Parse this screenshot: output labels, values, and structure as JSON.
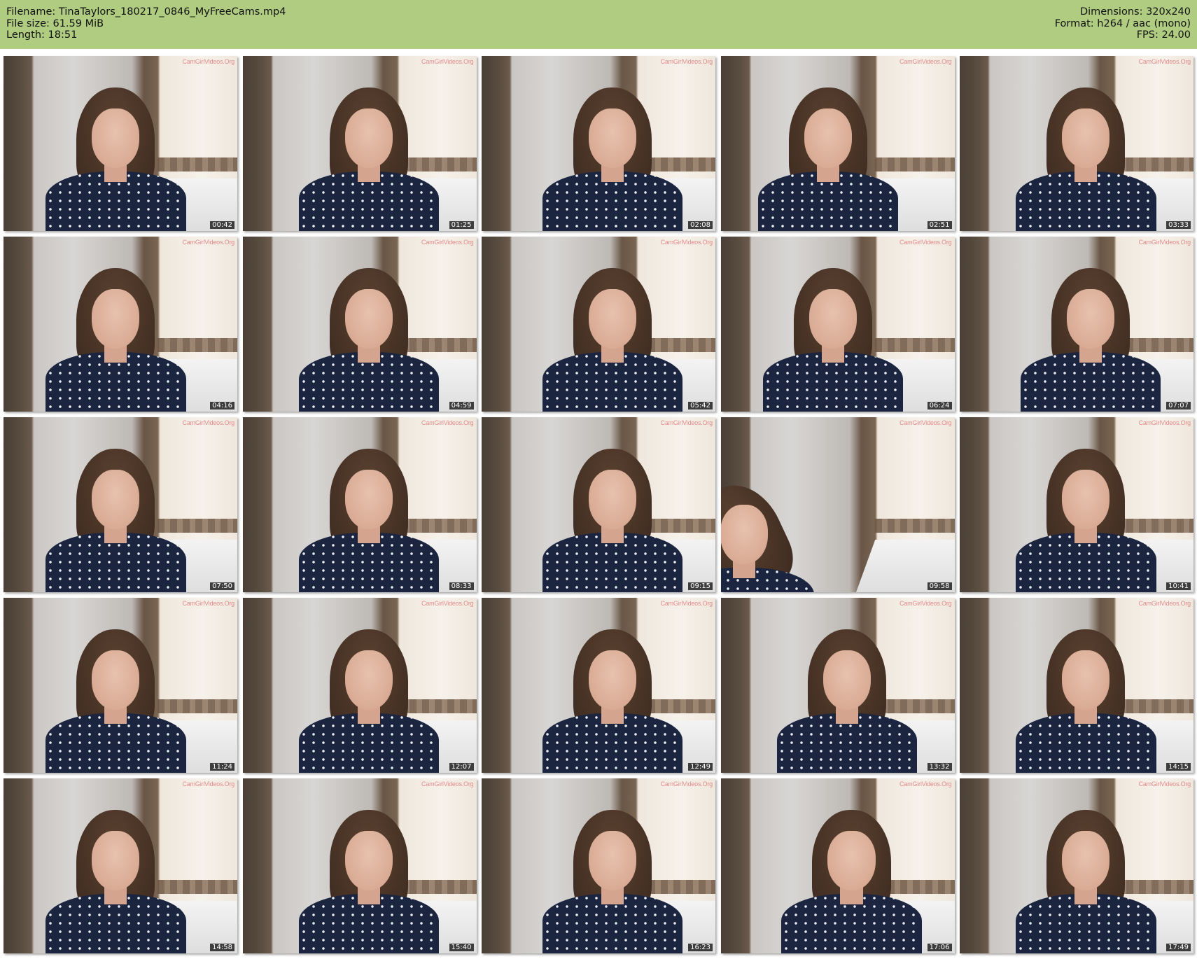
{
  "header": {
    "left": [
      {
        "label": "Filename:",
        "value": "TinaTaylors_180217_0846_MyFreeCams.mp4"
      },
      {
        "label": "File size:",
        "value": "61.59 MiB"
      },
      {
        "label": "Length:",
        "value": "18:51"
      }
    ],
    "right": [
      {
        "label": "Dimensions:",
        "value": "320x240"
      },
      {
        "label": "Format:",
        "value": "h264 / aac (mono)"
      },
      {
        "label": "FPS:",
        "value": "24.00"
      }
    ]
  },
  "watermark_text": "CamGirlVideos.Org",
  "thumbnails": [
    {
      "time": "00:42"
    },
    {
      "time": "01:25"
    },
    {
      "time": "02:08"
    },
    {
      "time": "02:51"
    },
    {
      "time": "03:33"
    },
    {
      "time": "04:16"
    },
    {
      "time": "04:59"
    },
    {
      "time": "05:42"
    },
    {
      "time": "06:24"
    },
    {
      "time": "07:07"
    },
    {
      "time": "07:50"
    },
    {
      "time": "08:33"
    },
    {
      "time": "09:15"
    },
    {
      "time": "09:58"
    },
    {
      "time": "10:41"
    },
    {
      "time": "11:24"
    },
    {
      "time": "12:07"
    },
    {
      "time": "12:49"
    },
    {
      "time": "13:32"
    },
    {
      "time": "14:15"
    },
    {
      "time": "14:58"
    },
    {
      "time": "15:40"
    },
    {
      "time": "16:23"
    },
    {
      "time": "17:06"
    },
    {
      "time": "17:49"
    }
  ]
}
